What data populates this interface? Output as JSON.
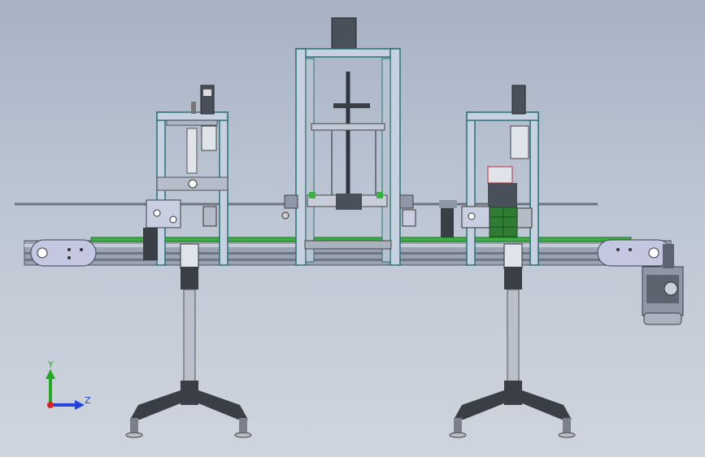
{
  "viewport": {
    "background_top": "#a7b2c4",
    "background_bottom": "#cfd5de"
  },
  "triad": {
    "y_label": "Y",
    "z_label": "Z",
    "y_color": "#22aa22",
    "z_color": "#2244dd",
    "origin_color": "#dd2222"
  },
  "colors": {
    "frame_light": "#c7d2e0",
    "frame_dark": "#5a6472",
    "teal": "#1e8c9a",
    "belt": "#3cb043",
    "green_block": "#2e7d32",
    "leg_dark": "#3a3f46",
    "motor": "#8d97a6"
  }
}
